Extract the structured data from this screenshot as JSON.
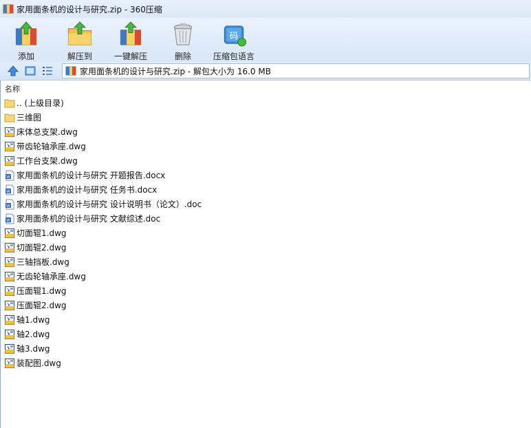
{
  "window": {
    "title": "家用面条机的设计与研究.zip - 360压缩"
  },
  "toolbar": {
    "buttons": [
      {
        "label": "添加",
        "icon": "add-archive-icon"
      },
      {
        "label": "解压到",
        "icon": "extract-to-icon"
      },
      {
        "label": "一键解压",
        "icon": "one-click-extract-icon"
      },
      {
        "label": "删除",
        "icon": "trash-icon"
      },
      {
        "label": "压缩包语言",
        "icon": "archive-language-icon"
      }
    ]
  },
  "nav": {
    "path": "家用面条机的设计与研究.zip - 解包大小为 16.0 MB",
    "buttons": [
      "up-arrow-icon",
      "thumbnail-view-icon",
      "list-view-icon"
    ]
  },
  "list": {
    "column_name": "名称",
    "items": [
      {
        "name": ".. (上级目录)",
        "type": "folder"
      },
      {
        "name": "三维图",
        "type": "folder"
      },
      {
        "name": "床体总支架.dwg",
        "type": "dwg"
      },
      {
        "name": "带齿轮轴承座.dwg",
        "type": "dwg"
      },
      {
        "name": "工作台支架.dwg",
        "type": "dwg"
      },
      {
        "name": "家用面条机的设计与研究 开题报告.docx",
        "type": "doc"
      },
      {
        "name": "家用面条机的设计与研究 任务书.docx",
        "type": "doc"
      },
      {
        "name": "家用面条机的设计与研究 设计说明书（论文）.doc",
        "type": "doc"
      },
      {
        "name": "家用面条机的设计与研究 文献综述.doc",
        "type": "doc"
      },
      {
        "name": "切面辊1.dwg",
        "type": "dwg"
      },
      {
        "name": "切面辊2.dwg",
        "type": "dwg"
      },
      {
        "name": "三轴挡板.dwg",
        "type": "dwg"
      },
      {
        "name": "无齿轮轴承座.dwg",
        "type": "dwg"
      },
      {
        "name": "压面辊1.dwg",
        "type": "dwg"
      },
      {
        "name": "压面辊2.dwg",
        "type": "dwg"
      },
      {
        "name": "轴1.dwg",
        "type": "dwg"
      },
      {
        "name": "轴2.dwg",
        "type": "dwg"
      },
      {
        "name": "轴3.dwg",
        "type": "dwg"
      },
      {
        "name": "装配图.dwg",
        "type": "dwg"
      }
    ]
  },
  "colors": {
    "title_bg": "#dbe8f7",
    "toolbar_bg": "#d9e7f7",
    "path_border": "#a9bfd8",
    "folder": "#f5c64f",
    "doc_blue": "#2b5fb4"
  }
}
